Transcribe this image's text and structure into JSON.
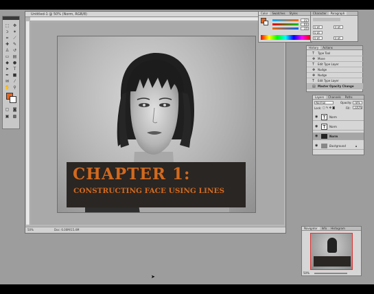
{
  "document": {
    "title": "Untitled-1 @ 50% (Norm, RGB/8)",
    "zoom": "50%",
    "doc_info": "Doc: 6.00M/15.4M"
  },
  "artwork": {
    "heading": "CHAPTER 1:",
    "subheading": "CONSTRUCTING FACE USING LINES",
    "accent_color": "#d2691e"
  },
  "toolbox": {
    "foreground_color": "#e5651e",
    "background_color": "#ffffff"
  },
  "color_panel": {
    "tabs": [
      "Color",
      "Swatches",
      "Styles"
    ],
    "r": "22",
    "g": "69",
    "b": "34"
  },
  "paragraph_panel": {
    "tabs": [
      "Character",
      "Paragraph"
    ],
    "values": [
      "0 pt",
      "0 pt",
      "0 pt",
      "0 pt",
      "0 pt"
    ]
  },
  "history_panel": {
    "tabs": [
      "History",
      "Actions"
    ],
    "items": [
      "Type Tool",
      "Move",
      "Edit Type Layer",
      "Nudge",
      "Nudge",
      "Edit Type Layer",
      "Master Opacity Change"
    ]
  },
  "layers_panel": {
    "tabs": [
      "Layers",
      "Channels",
      "Paths"
    ],
    "blend_mode": "Normal",
    "opacity_label": "Opacity:",
    "opacity": "78%",
    "lock_label": "Lock:",
    "fill_label": "Fill:",
    "fill": "100%",
    "layers": [
      "Norm",
      "Norm",
      "Norm",
      "Background"
    ]
  },
  "navigator_panel": {
    "tabs": [
      "Navigator",
      "Info",
      "Histogram"
    ],
    "zoom": "50%"
  }
}
